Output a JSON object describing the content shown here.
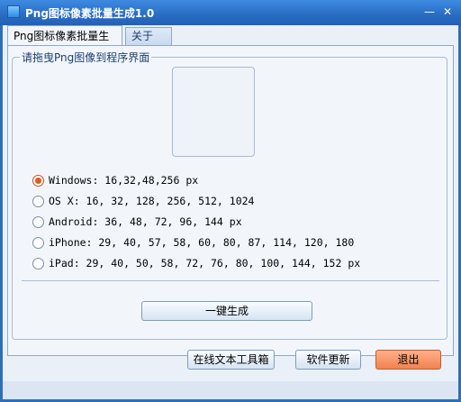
{
  "window": {
    "title": "Png图标像素批量生成1.0",
    "min_label": "—",
    "close_label": "✕"
  },
  "tabs": [
    {
      "label": "Png图标像素批量生成",
      "active": true
    },
    {
      "label": "关于",
      "active": false
    }
  ],
  "group": {
    "legend": "请拖曳Png图像到程序界面"
  },
  "options": [
    {
      "label": "Windows: 16,32,48,256 px",
      "checked": true
    },
    {
      "label": "OS X: 16, 32, 128, 256, 512, 1024",
      "checked": false
    },
    {
      "label": "Android: 36, 48, 72, 96, 144 px",
      "checked": false
    },
    {
      "label": "iPhone: 29, 40, 57, 58, 60, 80, 87, 114, 120, 180",
      "checked": false
    },
    {
      "label": "iPad: 29, 40, 50, 58, 72, 76, 80, 100, 144, 152 px",
      "checked": false
    }
  ],
  "buttons": {
    "generate": "一键生成",
    "tools": "在线文本工具箱",
    "update": "软件更新",
    "exit": "退出"
  },
  "colors": {
    "titlebar": "#2a6cc4",
    "client": "#e9f0f8",
    "accent_exit": "#f08250",
    "radio_checked": "#e25a1e"
  }
}
